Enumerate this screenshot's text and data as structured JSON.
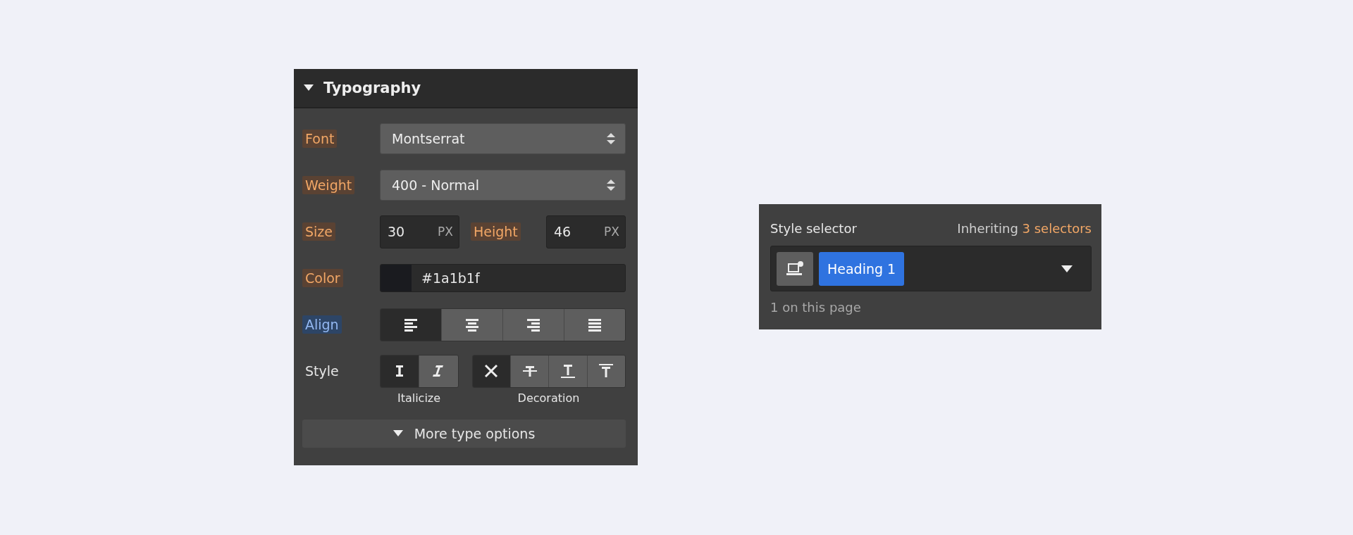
{
  "typography": {
    "title": "Typography",
    "expanded": true,
    "font": {
      "label": "Font",
      "inherited": true,
      "set": false,
      "value": "Montserrat"
    },
    "weight": {
      "label": "Weight",
      "inherited": true,
      "set": false,
      "value": "400 - Normal"
    },
    "size": {
      "label": "Size",
      "inherited": true,
      "set": false,
      "value": "30",
      "unit": "PX"
    },
    "height": {
      "label": "Height",
      "inherited": true,
      "set": false,
      "value": "46",
      "unit": "PX"
    },
    "color": {
      "label": "Color",
      "inherited": true,
      "set": false,
      "value": "#1a1b1f"
    },
    "align": {
      "label": "Align",
      "inherited": false,
      "set": true,
      "options": [
        {
          "kind": "left",
          "selected": true
        },
        {
          "kind": "center",
          "selected": false
        },
        {
          "kind": "right",
          "selected": false
        },
        {
          "kind": "justify",
          "selected": false
        }
      ]
    },
    "style": {
      "label": "Style",
      "inherited": false,
      "set": false,
      "italicize": {
        "caption": "Italicize",
        "options": [
          {
            "kind": "regular",
            "selected": true
          },
          {
            "kind": "italic",
            "selected": false
          }
        ]
      },
      "decoration": {
        "caption": "Decoration",
        "options": [
          {
            "kind": "none",
            "selected": true
          },
          {
            "kind": "strikethrough",
            "selected": false
          },
          {
            "kind": "underline",
            "selected": false
          },
          {
            "kind": "overline",
            "selected": false
          }
        ]
      }
    },
    "more": {
      "label": "More type options"
    }
  },
  "style_selector": {
    "title": "Style selector",
    "inheriting": {
      "prefix": "Inheriting",
      "link": "3 selectors"
    },
    "tag": "Heading 1",
    "count": "1 on this page"
  }
}
